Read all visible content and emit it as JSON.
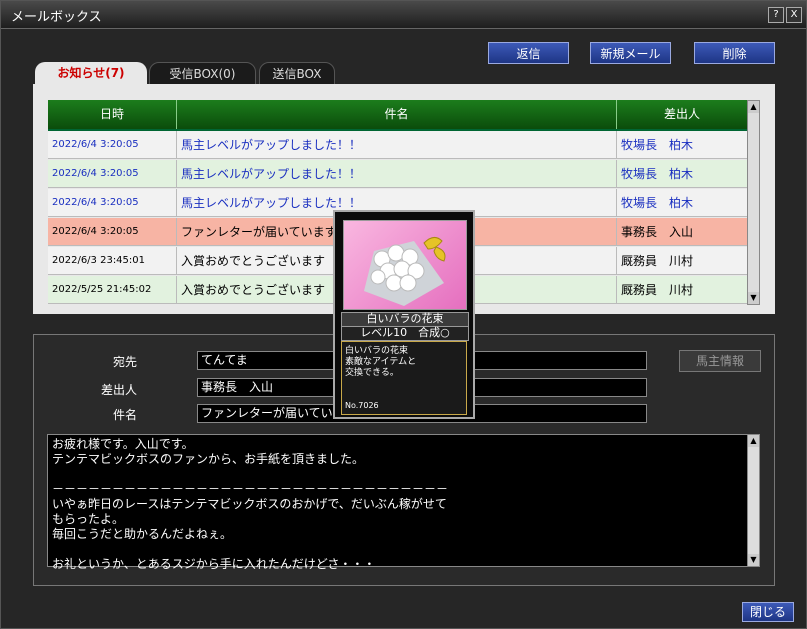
{
  "window": {
    "title": "メールボックス",
    "help_label": "?",
    "close_label": "X"
  },
  "toolbar": {
    "reply_label": "返信",
    "new_label": "新規メール",
    "delete_label": "削除"
  },
  "tabs": [
    {
      "label": "お知らせ(7)",
      "active": true
    },
    {
      "label": "受信BOX(0)",
      "active": false
    },
    {
      "label": "送信BOX",
      "active": false
    }
  ],
  "list": {
    "headers": {
      "date": "日時",
      "subject": "件名",
      "sender": "差出人"
    },
    "rows": [
      {
        "date": "2022/6/4 3:20:05",
        "subject": "馬主レベルがアップしました！！",
        "sender": "牧場長　柏木",
        "unread": true,
        "selected": false,
        "bg": "#f2f2f2"
      },
      {
        "date": "2022/6/4 3:20:05",
        "subject": "馬主レベルがアップしました！！",
        "sender": "牧場長　柏木",
        "unread": true,
        "selected": false,
        "bg": "#e2f2df"
      },
      {
        "date": "2022/6/4 3:20:05",
        "subject": "馬主レベルがアップしました！！",
        "sender": "牧場長　柏木",
        "unread": true,
        "selected": false,
        "bg": "#f2f2f2"
      },
      {
        "date": "2022/6/4 3:20:05",
        "subject": "ファンレターが届いています。",
        "sender": "事務長　入山",
        "unread": false,
        "selected": true,
        "bg": "#f7b4a4"
      },
      {
        "date": "2022/6/3 23:45:01",
        "subject": "入賞おめでとうございます",
        "sender": "厩務員　川村",
        "unread": false,
        "selected": false,
        "bg": "#f2f2f2"
      },
      {
        "date": "2022/5/25 21:45:02",
        "subject": "入賞おめでとうございます",
        "sender": "厩務員　川村",
        "unread": false,
        "selected": false,
        "bg": "#e2f2df"
      }
    ]
  },
  "detail": {
    "to_label": "宛先",
    "to_value": "てんてま",
    "from_label": "差出人",
    "from_value": "事務長　入山",
    "subject_label": "件名",
    "subject_value": "ファンレターが届いています。",
    "owner_info_label": "馬主情報",
    "body_lines": [
      "お疲れ様です。入山です。",
      "テンテマビックボスのファンから、お手紙を頂きました。",
      "",
      "－－－－－－－－－－－－－－－－－－－－－－－－－－－－－－－－－",
      "いやぁ昨日のレースはテンテマビックボスのおかげで、だいぶん稼がせて",
      "もらったよ。",
      "毎回こうだと助かるんだよねぇ。",
      "",
      "お礼というか、とあるスジから手に入れたんだけどさ・・・"
    ]
  },
  "card": {
    "name": "白いバラの花束",
    "level": "レベル10　合成○",
    "desc_lines": [
      "白いバラの花束",
      "素敵なアイテムと",
      "交換できる。"
    ],
    "number": "No.7026"
  },
  "footer": {
    "close_label": "閉じる"
  },
  "colors": {
    "unread_text": "#1a2fc0",
    "read_text": "#000000",
    "selected_row": "#f7b4a4",
    "header_green": "#0b4c0b",
    "button_blue": "#1e3585"
  }
}
